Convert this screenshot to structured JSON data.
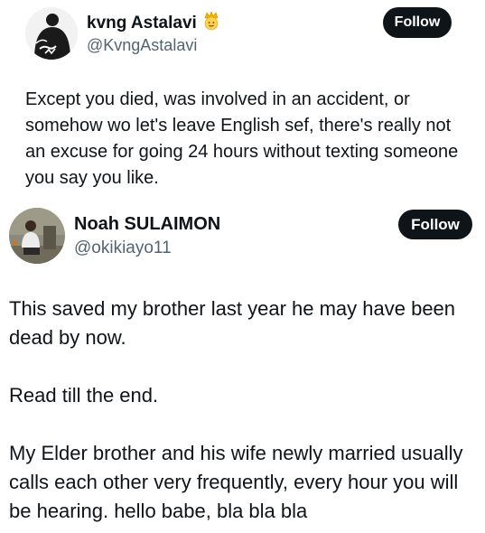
{
  "posts": [
    {
      "author": {
        "name": "kvng Astalavi",
        "badge_icon": "crowned-face-emoji",
        "handle": "@KvngAstalavi",
        "avatar_icon": "avatar-dark-figure"
      },
      "follow_label": "Follow",
      "text": "Except you died, was involved in an accident, or somehow wo let's leave English sef, there's really not an excuse for going 24 hours without texting someone you say you like."
    },
    {
      "author": {
        "name": "Noah SULAIMON",
        "handle": "@okikiayo11",
        "avatar_icon": "avatar-photo-person"
      },
      "follow_label": "Follow",
      "paragraphs": [
        "This saved my brother last year he may have been dead by now.",
        "Read till the end.",
        "My Elder brother and his wife newly married usually calls each other very frequently, every hour you will be hearing. hello babe, bla bla bla"
      ]
    }
  ],
  "colors": {
    "text": "#0f1419",
    "secondary_text": "#536471",
    "button_bg": "#0f1419",
    "button_text": "#ffffff",
    "background": "#ffffff"
  }
}
